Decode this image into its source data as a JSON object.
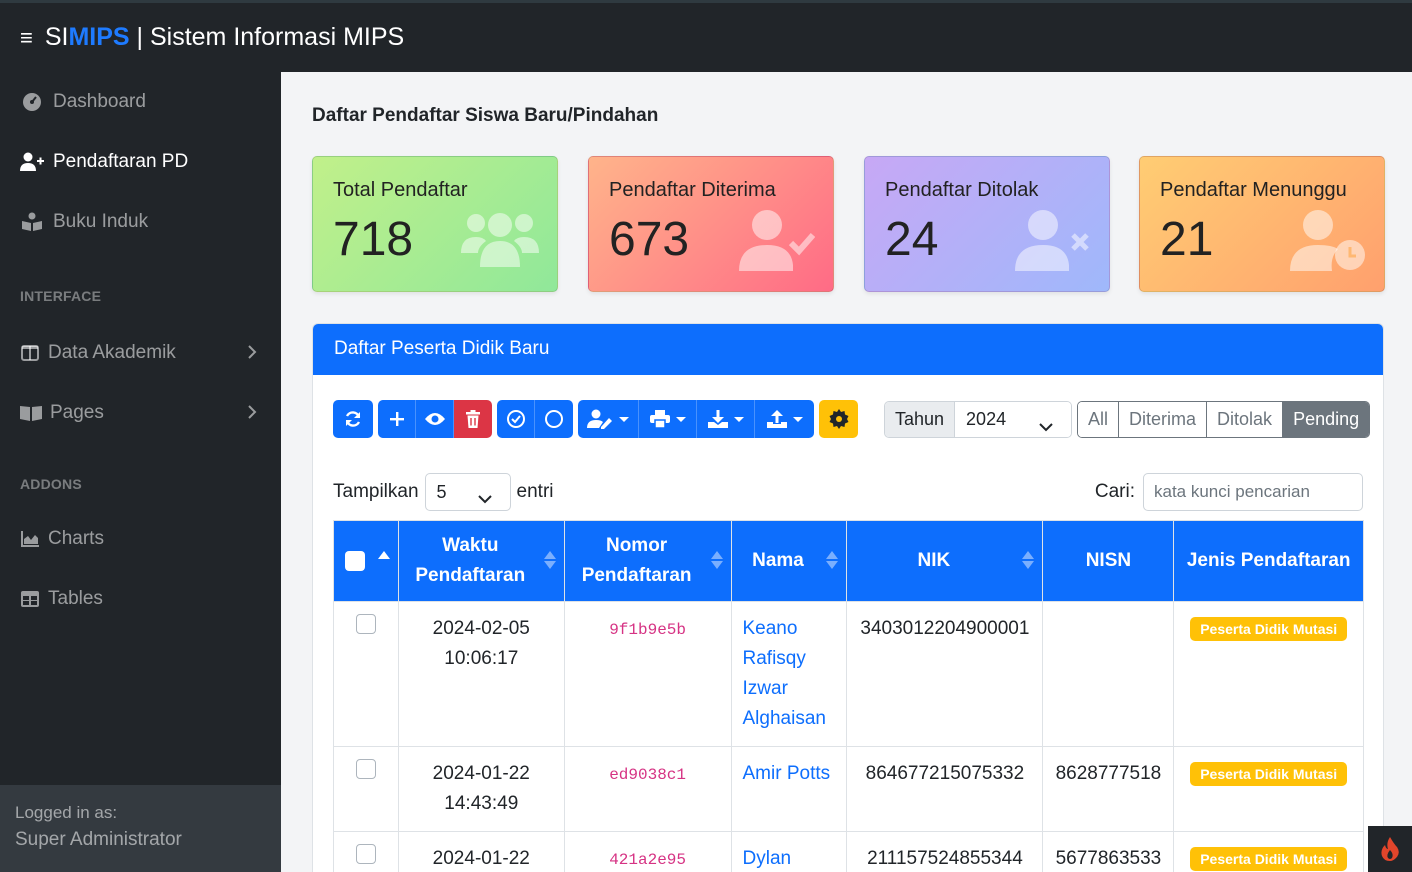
{
  "app": {
    "brand_si": "SI",
    "brand_mips": "MIPS",
    "brand_rest": " | Sistem Informasi MIPS"
  },
  "sidebar": {
    "items": [
      {
        "label": "Dashboard",
        "icon": "tachometer-icon"
      },
      {
        "label": "Pendaftaran PD",
        "icon": "user-plus-icon",
        "active": true
      },
      {
        "label": "Buku Induk",
        "icon": "book-reader-icon"
      }
    ],
    "heading_interface": "INTERFACE",
    "interface_items": [
      {
        "label": "Data Akademik",
        "icon": "columns-icon"
      },
      {
        "label": "Pages",
        "icon": "book-open-icon"
      }
    ],
    "heading_addons": "ADDONS",
    "addon_items": [
      {
        "label": "Charts",
        "icon": "chart-area-icon"
      },
      {
        "label": "Tables",
        "icon": "table-icon"
      }
    ],
    "footer": {
      "label": "Logged in as:",
      "user": "Super Administrator"
    }
  },
  "page": {
    "title": "Daftar Pendaftar Siswa Baru/Pindahan"
  },
  "stats": [
    {
      "title": "Total Pendaftar",
      "value": "718",
      "icon": "users-icon"
    },
    {
      "title": "Pendaftar Diterima",
      "value": "673",
      "icon": "user-check-icon"
    },
    {
      "title": "Pendaftar Ditolak",
      "value": "24",
      "icon": "user-times-icon"
    },
    {
      "title": "Pendaftar Menunggu",
      "value": "21",
      "icon": "user-clock-icon"
    }
  ],
  "card": {
    "title": "Daftar Peserta Didik Baru"
  },
  "filters": {
    "year_label": "Tahun",
    "year_value": "2024",
    "status_buttons": [
      "All",
      "Diterima",
      "Ditolak",
      "Pending"
    ],
    "active_status": "Pending"
  },
  "table_controls": {
    "show_label": "Tampilkan",
    "length_value": "5",
    "entries_label": "entri",
    "search_label": "Cari:",
    "search_placeholder": "kata kunci pencarian"
  },
  "table": {
    "headers": {
      "waktu_1": "Waktu",
      "waktu_2": "Pendaftaran",
      "nomor_1": "Nomor",
      "nomor_2": "Pendaftaran",
      "nama": "Nama",
      "nik": "NIK",
      "nisn": "NISN",
      "jenis": "Jenis Pendaftaran"
    },
    "rows": [
      {
        "date": "2024-02-05",
        "time": "10:06:17",
        "nomor": "9f1b9e5b",
        "nama_lines": [
          "Keano",
          "Rafisqy",
          "Izwar",
          "Alghaisan"
        ],
        "nik": "3403012204900001",
        "nisn": "",
        "jenis": "Peserta Didik Mutasi"
      },
      {
        "date": "2024-01-22",
        "time": "14:43:49",
        "nomor": "ed9038c1",
        "nama_lines": [
          "Amir Potts"
        ],
        "nik": "864677215075332",
        "nisn": "8628777518",
        "jenis": "Peserta Didik Mutasi"
      },
      {
        "date": "2024-01-22",
        "time": "",
        "nomor": "421a2e95",
        "nama_lines": [
          "Dylan"
        ],
        "nik": "211157524855344",
        "nisn": "5677863533",
        "jenis": "Peserta Didik Mutasi"
      }
    ]
  },
  "colors": {
    "primary": "#0d6efd",
    "danger": "#dc3545",
    "warning": "#ffc107",
    "sidebar": "#212529"
  }
}
